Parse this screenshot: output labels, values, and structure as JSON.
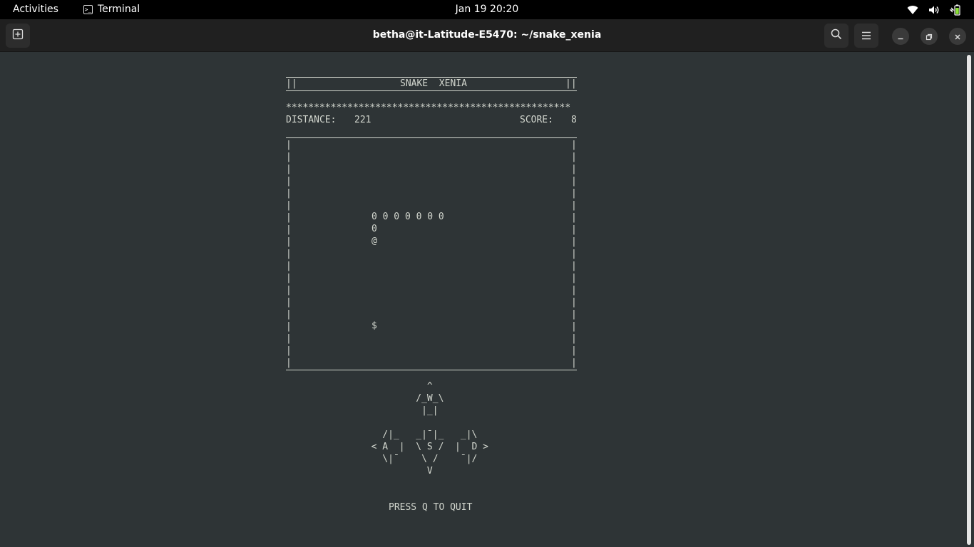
{
  "topbar": {
    "activities": "Activities",
    "app_name": "Terminal",
    "app_icon_glyph": ">_",
    "clock": "Jan 19  20:20",
    "icons": [
      "wifi-icon",
      "volume-icon",
      "battery-icon"
    ]
  },
  "headerbar": {
    "title": "betha@it-Latitude-E5470: ~/snake_xenia",
    "icons": [
      "new-tab-icon",
      "search-icon",
      "hamburger-menu-icon",
      "minimize-icon",
      "restore-icon",
      "close-icon"
    ]
  },
  "game": {
    "title": "SNAKE  XENIA",
    "title_left_marker": "||",
    "title_right_marker": "||",
    "stars": "***************************************************",
    "distance_label": "DISTANCE:",
    "distance_value": "221",
    "score_label": "SCORE:",
    "score_value": "8",
    "snake_body_row": "0 0 0 0 0 0 0",
    "snake_body_single": "0",
    "snake_head": "@",
    "food": "$",
    "board_left_border": "|\n|\n|\n|\n|\n|\n|\n|\n|\n|\n|\n|\n|\n|\n|\n|\n|\n|\n|",
    "board_right_border": "|\n|\n|\n|\n|\n|\n|\n|\n|\n|\n|\n|\n|\n|\n|\n|\n|\n|\n|",
    "controls_art": "            ^\n          /_W_\\\n           |_|\n\n    /|_   _|¯|_   _|\\\n  < A  |  \\ S /  |  D >\n    \\|¯    \\ /    ¯|/\n            V",
    "quit_text": "PRESS Q TO QUIT"
  },
  "colors": {
    "terminal_bg": "#2e3436",
    "terminal_fg": "#d3d7cf",
    "headerbar_bg": "#202020",
    "topbar_bg": "#000000"
  }
}
